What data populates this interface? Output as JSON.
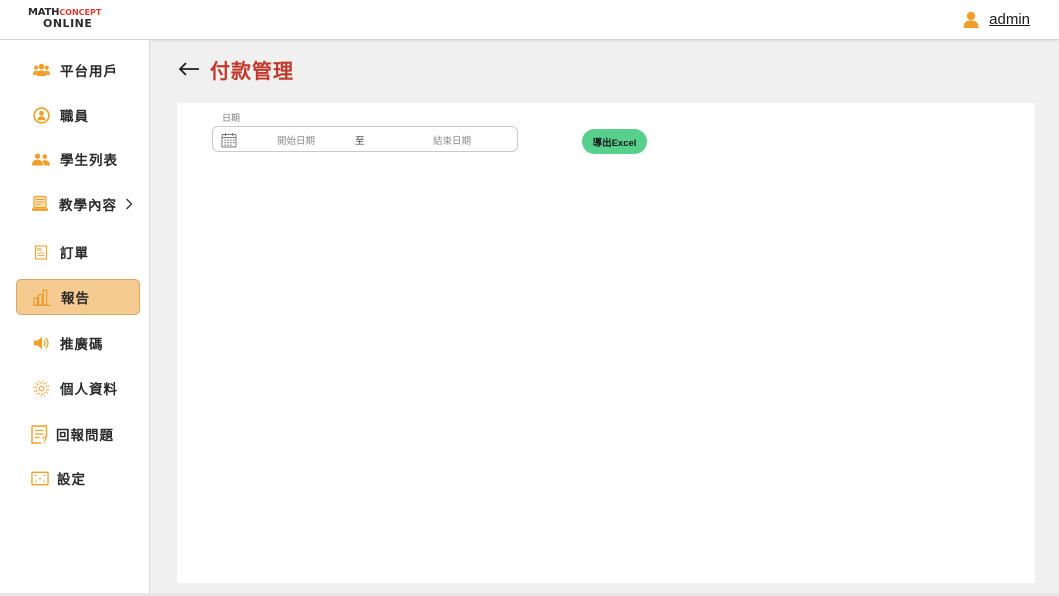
{
  "header": {
    "logo": {
      "line1_a": "Math",
      "line1_b": "Concept",
      "line2": "ONLINE"
    },
    "user_name": "admin"
  },
  "sidebar": {
    "items": [
      {
        "label": "平台用戶",
        "icon": "users-group-icon"
      },
      {
        "label": "職員",
        "icon": "staff-avatar-icon"
      },
      {
        "label": "學生列表",
        "icon": "students-icon"
      },
      {
        "label": "教學內容",
        "icon": "teaching-monitor-icon",
        "has_submenu": true
      },
      {
        "label": "訂單",
        "icon": "order-receipt-icon"
      },
      {
        "label": "報告",
        "icon": "bar-chart-icon",
        "active": true
      },
      {
        "label": "推廣碼",
        "icon": "megaphone-icon"
      },
      {
        "label": "個人資料",
        "icon": "gear-icon"
      },
      {
        "label": "回報問題",
        "icon": "report-document-icon"
      },
      {
        "label": "設定",
        "icon": "settings-frame-icon"
      }
    ]
  },
  "main": {
    "title": "付款管理",
    "date_filter": {
      "label": "日期",
      "start_placeholder": "開始日期",
      "separator": "至",
      "end_placeholder": "結束日期"
    },
    "export_label": "導出Excel"
  },
  "colors": {
    "accent_title": "#c0392b",
    "active_nav_bg": "#f6cb91",
    "icon_orange": "#f0a02a",
    "export_button": "#57d08c"
  }
}
